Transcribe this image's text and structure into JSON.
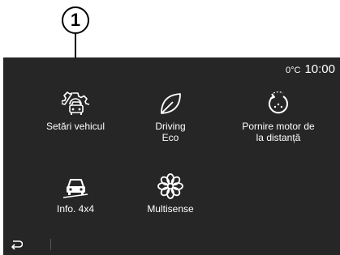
{
  "callout": {
    "number": "1"
  },
  "status": {
    "temperature": "0°C",
    "time": "10:00"
  },
  "tiles": [
    {
      "label": "Setări vehicul",
      "icon": "vehicle-settings-icon"
    },
    {
      "label": "Driving\nEco",
      "icon": "leaf-icon"
    },
    {
      "label": "Pornire motor de\nla distanță",
      "icon": "remote-start-icon"
    },
    {
      "label": "Info. 4x4",
      "icon": "offroad-vehicle-icon"
    },
    {
      "label": "Multisense",
      "icon": "multisense-flower-icon"
    }
  ],
  "bottom_bar": {
    "back_icon": "back-arrow-icon"
  },
  "colors": {
    "screen_background": "#262626",
    "text": "#ffffff"
  }
}
